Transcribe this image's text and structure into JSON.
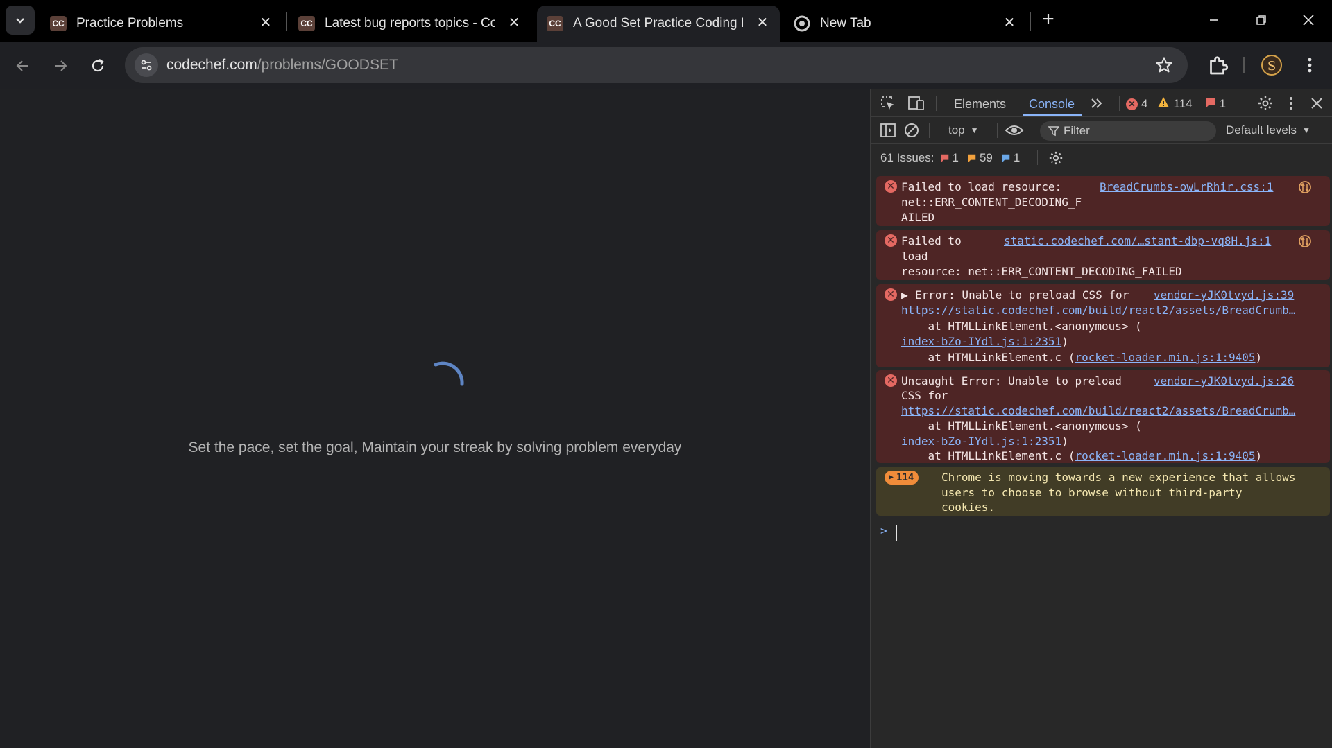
{
  "tabs": [
    {
      "title": "Practice Problems",
      "favicon": "CC"
    },
    {
      "title": "Latest bug reports topics - Cod",
      "favicon": "CC"
    },
    {
      "title": "A Good Set Practice Coding Pro",
      "favicon": "CC"
    },
    {
      "title": "New Tab",
      "favicon": "chrome-icon"
    }
  ],
  "url": {
    "domain": "codechef.com",
    "path": "/problems/GOODSET"
  },
  "page": {
    "message": "Set the pace, set the goal, Maintain your streak by solving problem everyday"
  },
  "devtools": {
    "tabs": {
      "elements": "Elements",
      "console": "Console"
    },
    "counts": {
      "errors": "4",
      "warnings": "114",
      "issues": "1"
    },
    "context": "top",
    "filter_placeholder": "Filter",
    "levels": "Default levels",
    "issues_bar": {
      "label": "61 Issues:",
      "errors": "1",
      "warnings": "59",
      "info": "1"
    },
    "messages": [
      {
        "lines": [
          "Failed to load resource:",
          "net::ERR_CONTENT_DECODING_F",
          "AILED"
        ],
        "source": "BreadCrumbs-owLrRhir.css:1"
      },
      {
        "lines": [
          "Failed to",
          "load",
          "resource: net::ERR_CONTENT_DECODING_FAILED"
        ],
        "source": "static.codechef.com/…stant-dbp-vq8H.js:1"
      },
      {
        "lines": [
          "Error: Unable to preload CSS for",
          "https://static.codechef.com/build/react2/assets/BreadCrumb…",
          "    at HTMLLinkElement.<anonymous> (",
          "index-bZo-IYdl.js:1:2351",
          ")",
          "    at HTMLLinkElement.c (",
          "rocket-loader.min.js:1:9405",
          ")"
        ],
        "source": "vendor-yJK0tvyd.js:39"
      },
      {
        "lines": [
          "Uncaught Error: Unable to preload",
          "CSS for",
          "https://static.codechef.com/build/react2/assets/BreadCrumb…",
          "    at HTMLLinkElement.<anonymous> (",
          "index-bZo-IYdl.js:1:2351",
          ")",
          "    at HTMLLinkElement.c (",
          "rocket-loader.min.js:1:9405",
          ")"
        ],
        "source": "vendor-yJK0tvyd.js:26"
      },
      {
        "badge": "114",
        "lines": [
          "Chrome is moving towards a new experience that allows",
          "users to choose to browse without third-party",
          "cookies."
        ]
      }
    ],
    "prompt": ">"
  }
}
